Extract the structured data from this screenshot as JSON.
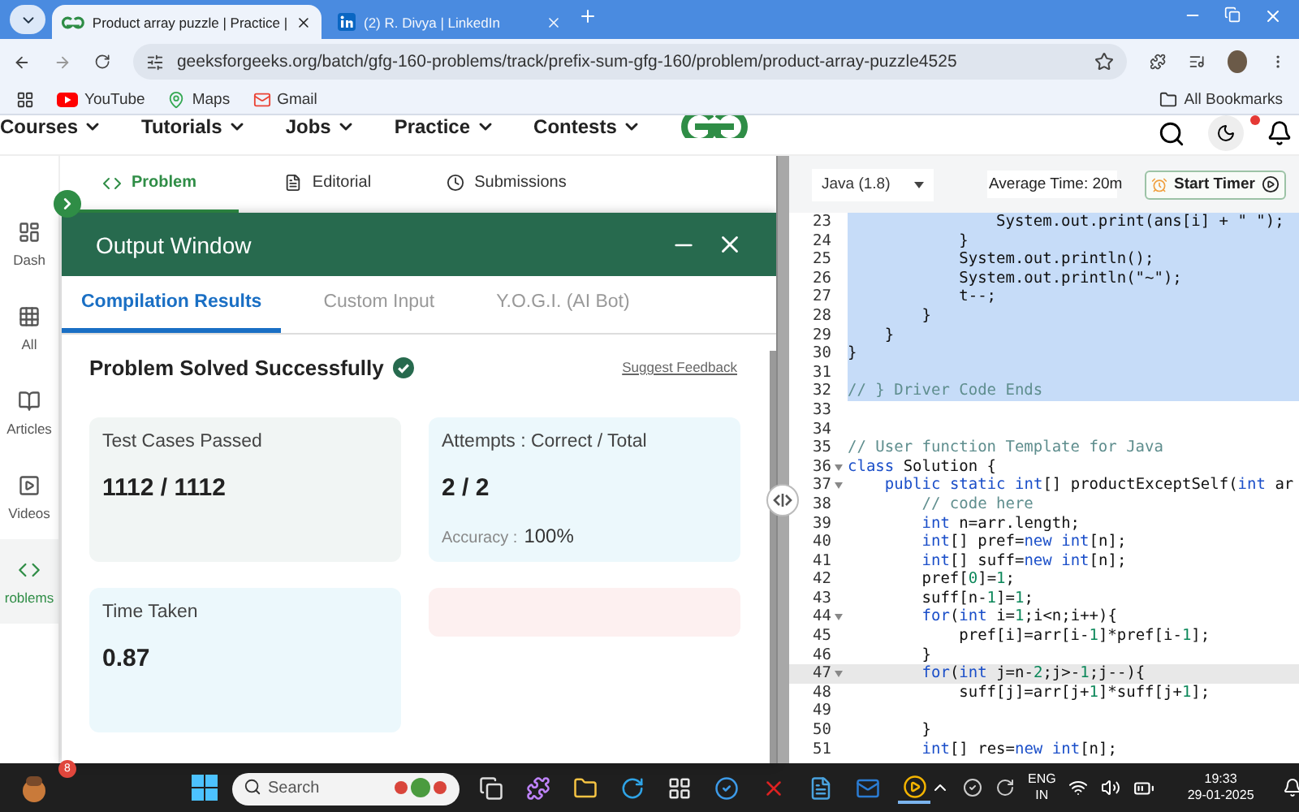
{
  "browser": {
    "tabs": [
      {
        "title": "Product array puzzle | Practice |",
        "kind": "gfg",
        "selected": true
      },
      {
        "title": "(2) R. Divya | LinkedIn",
        "kind": "linkedin",
        "selected": false
      }
    ],
    "url": "geeksforgeeks.org/batch/gfg-160-problems/track/prefix-sum-gfg-160/problem/product-array-puzzle4525",
    "bookmarks": [
      {
        "label": "YouTube",
        "kind": "video"
      },
      {
        "label": "Maps",
        "kind": "map"
      },
      {
        "label": "Gmail",
        "kind": "mail"
      }
    ],
    "all_bookmarks": "All Bookmarks"
  },
  "site_nav": {
    "items": [
      {
        "label": "Courses"
      },
      {
        "label": "Tutorials"
      },
      {
        "label": "Jobs"
      },
      {
        "label": "Practice"
      },
      {
        "label": "Contests"
      }
    ],
    "notification_dot": true
  },
  "sidebar": [
    {
      "label": "Dash",
      "kind": "dash",
      "selected": false
    },
    {
      "label": "All",
      "kind": "grid",
      "selected": false
    },
    {
      "label": "Articles",
      "kind": "book",
      "selected": false
    },
    {
      "label": "Videos",
      "kind": "video",
      "selected": false
    },
    {
      "label": "roblems",
      "kind": "code",
      "selected": true
    }
  ],
  "problem_tabs": [
    {
      "label": "Problem",
      "kind": "code",
      "selected": true
    },
    {
      "label": "Editorial",
      "kind": "doc",
      "selected": false
    },
    {
      "label": "Submissions",
      "kind": "clock",
      "selected": false
    }
  ],
  "output": {
    "title": "Output Window",
    "tabs": [
      {
        "label": "Compilation Results",
        "selected": true
      },
      {
        "label": "Custom Input",
        "selected": false
      },
      {
        "label": "Y.O.G.I. (AI Bot)",
        "selected": false
      }
    ],
    "status": "Problem Solved Successfully",
    "feedback_link": "Suggest Feedback",
    "cards": [
      {
        "label": "Test Cases Passed",
        "value": "1112 / 1112",
        "color": "#f1f5f4"
      },
      {
        "label": "Attempts : Correct / Total",
        "value": "2 / 2",
        "note_label": "Accuracy :",
        "note_value": "100%",
        "color": "#ecf8fc"
      },
      {
        "label": "Time Taken",
        "value": "0.87",
        "color": "#ecf8fc"
      },
      {
        "color": "#fdf0f0"
      }
    ]
  },
  "editor": {
    "language": "Java (1.8)",
    "average_time": "Average Time: 20m",
    "timer_button": "Start Timer",
    "lines": [
      {
        "number": "23",
        "text": "                System.out.print(ans[i] + \" \");",
        "kind": "code",
        "selected": true,
        "active": false,
        "foldable": false
      },
      {
        "number": "24",
        "text": "            }",
        "kind": "code",
        "selected": true,
        "active": false,
        "foldable": false
      },
      {
        "number": "25",
        "text": "            System.out.println();",
        "kind": "code",
        "selected": true,
        "active": false,
        "foldable": false
      },
      {
        "number": "26",
        "text": "            System.out.println(\"~\");",
        "kind": "code",
        "selected": true,
        "active": false,
        "foldable": false
      },
      {
        "number": "27",
        "text": "            t--;",
        "kind": "code",
        "selected": true,
        "active": false,
        "foldable": false
      },
      {
        "number": "28",
        "text": "        }",
        "kind": "code",
        "selected": true,
        "active": false,
        "foldable": false
      },
      {
        "number": "29",
        "text": "    }",
        "kind": "code",
        "selected": true,
        "active": false,
        "foldable": false
      },
      {
        "number": "30",
        "text": "}",
        "kind": "code",
        "selected": true,
        "active": false,
        "foldable": false
      },
      {
        "number": "31",
        "kind": "code",
        "selected": true,
        "active": false,
        "foldable": false
      },
      {
        "number": "32",
        "text": "// } Driver Code Ends",
        "kind": "comment",
        "selected": true,
        "active": false,
        "foldable": false
      },
      {
        "number": "33",
        "kind": "code",
        "selected": false,
        "active": false,
        "foldable": false
      },
      {
        "number": "34",
        "kind": "code",
        "selected": false,
        "active": false,
        "foldable": false
      },
      {
        "number": "35",
        "text": "// User function Template for Java",
        "kind": "comment",
        "selected": false,
        "active": false,
        "foldable": false
      },
      {
        "number": "36",
        "text": "class Solution {",
        "kind": "code",
        "selected": false,
        "active": false,
        "foldable": true
      },
      {
        "number": "37",
        "text": "    public static int[] productExceptSelf(int ar",
        "kind": "code",
        "selected": false,
        "active": false,
        "foldable": true
      },
      {
        "number": "38",
        "text": "        // code here",
        "kind": "comment",
        "selected": false,
        "active": false,
        "foldable": false
      },
      {
        "number": "39",
        "text": "        int n=arr.length;",
        "kind": "code",
        "selected": false,
        "active": false,
        "foldable": false
      },
      {
        "number": "40",
        "text": "        int[] pref=new int[n];",
        "kind": "code",
        "selected": false,
        "active": false,
        "foldable": false
      },
      {
        "number": "41",
        "text": "        int[] suff=new int[n];",
        "kind": "code",
        "selected": false,
        "active": false,
        "foldable": false
      },
      {
        "number": "42",
        "text": "        pref[0]=1;",
        "kind": "code",
        "selected": false,
        "active": false,
        "foldable": false
      },
      {
        "number": "43",
        "text": "        suff[n-1]=1;",
        "kind": "code",
        "selected": false,
        "active": false,
        "foldable": false
      },
      {
        "number": "44",
        "text": "        for(int i=1;i<n;i++){",
        "kind": "code",
        "selected": false,
        "active": false,
        "foldable": true
      },
      {
        "number": "45",
        "text": "            pref[i]=arr[i-1]*pref[i-1];",
        "kind": "code",
        "selected": false,
        "active": false,
        "foldable": false
      },
      {
        "number": "46",
        "text": "        }",
        "kind": "code",
        "selected": false,
        "active": false,
        "foldable": false
      },
      {
        "number": "47",
        "text": "        for(int j=n-2;j>-1;j--){",
        "kind": "code",
        "selected": false,
        "active": true,
        "foldable": true
      },
      {
        "number": "48",
        "text": "            suff[j]=arr[j+1]*suff[j+1];",
        "kind": "code",
        "selected": false,
        "active": false,
        "foldable": false
      },
      {
        "number": "49",
        "kind": "code",
        "selected": false,
        "active": false,
        "foldable": false
      },
      {
        "number": "50",
        "text": "        }",
        "kind": "code",
        "selected": false,
        "active": false,
        "foldable": false
      },
      {
        "number": "51",
        "text": "        int[] res=new int[n];",
        "kind": "code",
        "selected": false,
        "active": false,
        "foldable": false
      }
    ]
  },
  "taskbar": {
    "badge": "8",
    "search_placeholder": "Search",
    "language": "ENG",
    "region": "IN",
    "time": "19:33",
    "date": "29-01-2025"
  }
}
